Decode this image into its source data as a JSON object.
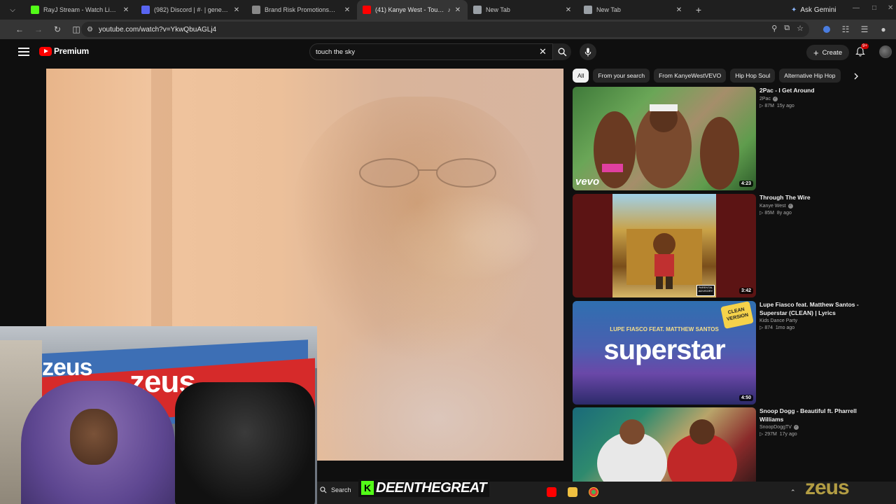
{
  "browser": {
    "tabs": [
      {
        "label": "RayJ Stream - Watch Live on Ki",
        "favicon": "kick",
        "color": "#53fc18"
      },
      {
        "label": "(982) Discord | #· | general |",
        "favicon": "discord",
        "color": "#5865f2"
      },
      {
        "label": "Brand Risk Promotions™ Event:",
        "favicon": "brand",
        "color": "#888888"
      },
      {
        "label": "(41) Kanye West - Touch Th",
        "favicon": "youtube",
        "color": "#ff0000",
        "active": true
      },
      {
        "label": "New Tab",
        "favicon": "chrome",
        "color": "#9aa0a6"
      },
      {
        "label": "New Tab",
        "favicon": "chrome",
        "color": "#9aa0a6"
      }
    ],
    "gemini_label": "Ask Gemini",
    "url": "youtube.com/watch?v=YkwQbuAGLj4"
  },
  "youtube": {
    "logo_label": "Premium",
    "search_value": "touch the sky",
    "create_label": "Create",
    "notification_badge": "9+",
    "chips": [
      "All",
      "From your search",
      "From KanyeWestVEVO",
      "Hip Hop Soul",
      "Alternative Hip Hop"
    ],
    "recommendations": [
      {
        "title": "2Pac - I Get Around",
        "channel": "2Pac",
        "verified": true,
        "views": "87M",
        "age": "15y ago",
        "duration": "4:23"
      },
      {
        "title": "Through The Wire",
        "channel": "Kanye West",
        "verified": true,
        "views": "85M",
        "age": "8y ago",
        "duration": "3:42"
      },
      {
        "title": "Lupe Fiasco feat. Matthew Santos - Superstar (CLEAN) | Lyrics",
        "channel": "Kids Dance Party",
        "verified": false,
        "views": "874",
        "age": "1mo ago",
        "duration": "4:50"
      },
      {
        "title": "Snoop Dogg - Beautiful ft. Pharrell Williams",
        "channel": "SnoopDoggTV",
        "verified": true,
        "views": "297M",
        "age": "17y ago",
        "duration": ""
      }
    ],
    "thumb_text": {
      "vevo": "vevo",
      "superstar_sub": "LUPE FIASCO FEAT. MATTHEW SANTOS",
      "superstar_big": "superstar",
      "clean_badge": "CLEAN VERSION"
    }
  },
  "stream_overlay": {
    "streamer_name": "DEENTHEGREAT",
    "kick_letter": "K",
    "watermark": "zeus",
    "banner_text": "zeus"
  },
  "taskbar": {
    "search_label": "Search"
  }
}
